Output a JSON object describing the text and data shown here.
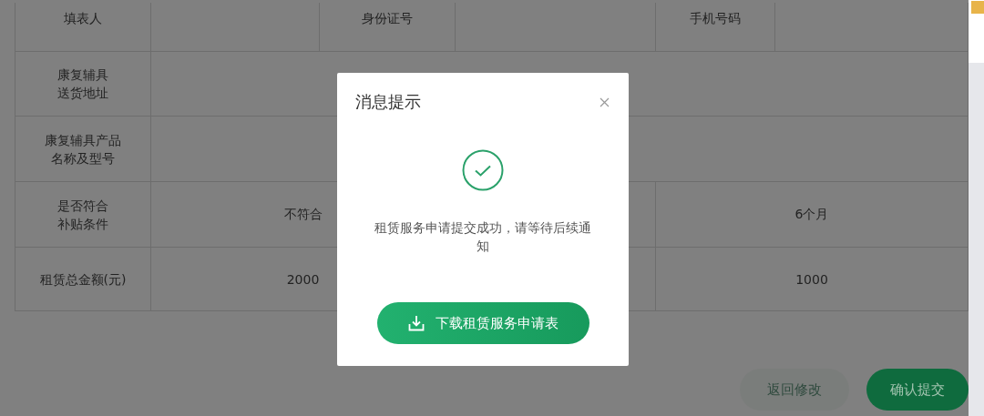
{
  "form_rows": [
    {
      "kind": "contact",
      "label": "填表人",
      "id_label": "身份证号",
      "phone_label": "手机号码"
    },
    {
      "kind": "wide",
      "label_lines": [
        "康复辅具",
        "送货地址"
      ]
    },
    {
      "kind": "wide",
      "label_lines": [
        "康复辅具产品",
        "名称及型号"
      ]
    },
    {
      "kind": "pair",
      "label_lines": [
        "是否符合",
        "补贴条件"
      ],
      "value_1": "不符合",
      "value_2": "6个月"
    },
    {
      "kind": "pair",
      "label_lines": [
        "租赁总金额(元)"
      ],
      "value_1": "2000",
      "value_2": "1000"
    }
  ],
  "actions": [
    {
      "label": "返回修改",
      "kind": "secondary"
    },
    {
      "label": "确认提交",
      "kind": "primary"
    }
  ],
  "dialog": {
    "title": "消息提示",
    "message": "租赁服务申请提交成功，请等待后续通知",
    "button": "下载租赁服务申请表"
  }
}
